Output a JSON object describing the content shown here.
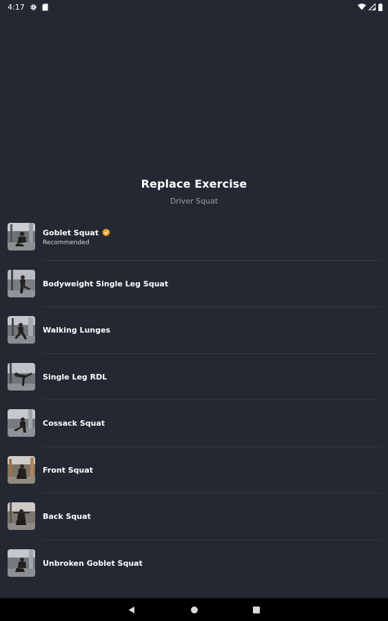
{
  "status_bar": {
    "time": "4:17",
    "left_icons": [
      "gear-icon",
      "sim-card-icon"
    ],
    "right_icons": [
      "wifi-icon",
      "cellular-signal-icon",
      "battery-icon"
    ]
  },
  "header": {
    "title": "Replace Exercise",
    "subtitle": "Driver Squat"
  },
  "exercises": [
    {
      "name": "Goblet Squat",
      "subtitle": "Recommended",
      "badge": "recommended-badge-icon"
    },
    {
      "name": "Bodyweight Single Leg Squat"
    },
    {
      "name": "Walking Lunges"
    },
    {
      "name": "Single Leg RDL"
    },
    {
      "name": "Cossack Squat"
    },
    {
      "name": "Front Squat"
    },
    {
      "name": "Back Squat"
    },
    {
      "name": "Unbroken Goblet Squat"
    }
  ],
  "nav_bar": {
    "buttons": [
      "back-icon",
      "home-icon",
      "recents-icon"
    ]
  },
  "colors": {
    "background": "#242832",
    "divider": "#343944",
    "subtitle_text": "#9aa0aa",
    "badge": "#f5a623",
    "nav_background": "#000000"
  }
}
